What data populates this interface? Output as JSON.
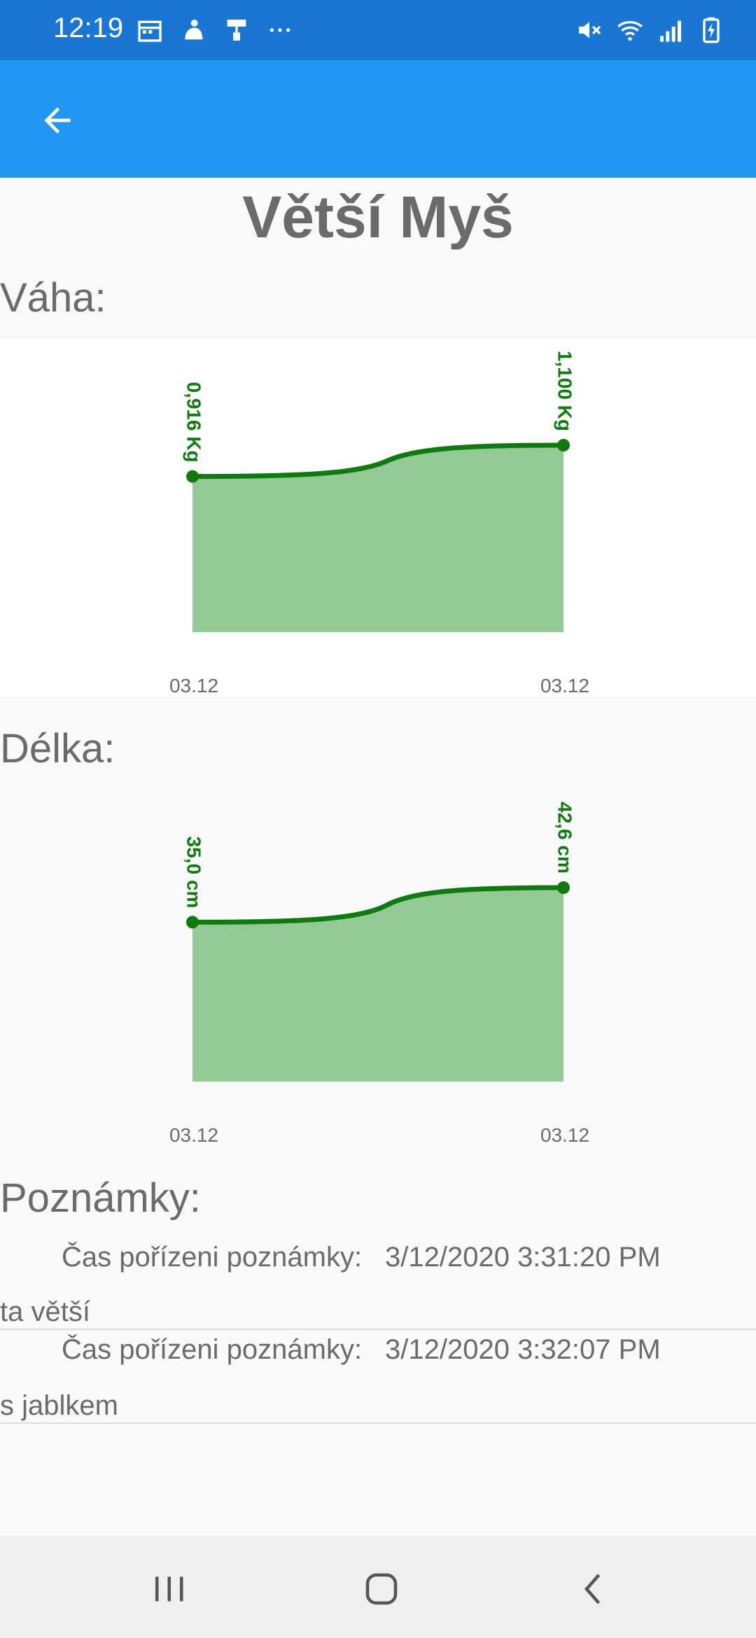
{
  "status_bar": {
    "time": "12:19",
    "left_icons": [
      "calendar-icon",
      "notification-icon",
      "paint-roller-icon",
      "more-dots-icon"
    ],
    "right_icons": [
      "mute-icon",
      "wifi-icon",
      "signal-icon",
      "battery-charging-icon"
    ]
  },
  "app_bar": {
    "back_icon": "arrow-back-icon",
    "color": "#2196f3",
    "status_color": "#1976d2"
  },
  "page": {
    "title": "Větší Myš"
  },
  "weight_section": {
    "label": "Váha:",
    "chart_data": {
      "type": "area",
      "x": [
        "03.12",
        "03.12"
      ],
      "values": [
        0.916,
        1.1
      ],
      "point_labels": [
        "0,916 Kg",
        "1,100 Kg"
      ],
      "line_color": "#0f7a0f",
      "fill_color": "#93c993"
    }
  },
  "length_section": {
    "label": "Délka:",
    "chart_data": {
      "type": "area",
      "x": [
        "03.12",
        "03.12"
      ],
      "values": [
        35.0,
        42.6
      ],
      "point_labels": [
        "35,0 cm",
        "42,6 cm"
      ],
      "line_color": "#0f7a0f",
      "fill_color": "#93c993"
    }
  },
  "notes": {
    "label": "Poznámky:",
    "items": [
      {
        "time_label": "Čas pořízeni poznámky:",
        "time_value": "3/12/2020 3:31:20 PM",
        "text": "ta větší"
      },
      {
        "time_label": "Čas pořízeni poznámky:",
        "time_value": "3/12/2020 3:32:07 PM",
        "text": "s jablkem"
      }
    ]
  },
  "nav_bar": {
    "icons": [
      "recent-apps-icon",
      "home-icon",
      "back-nav-icon"
    ]
  }
}
